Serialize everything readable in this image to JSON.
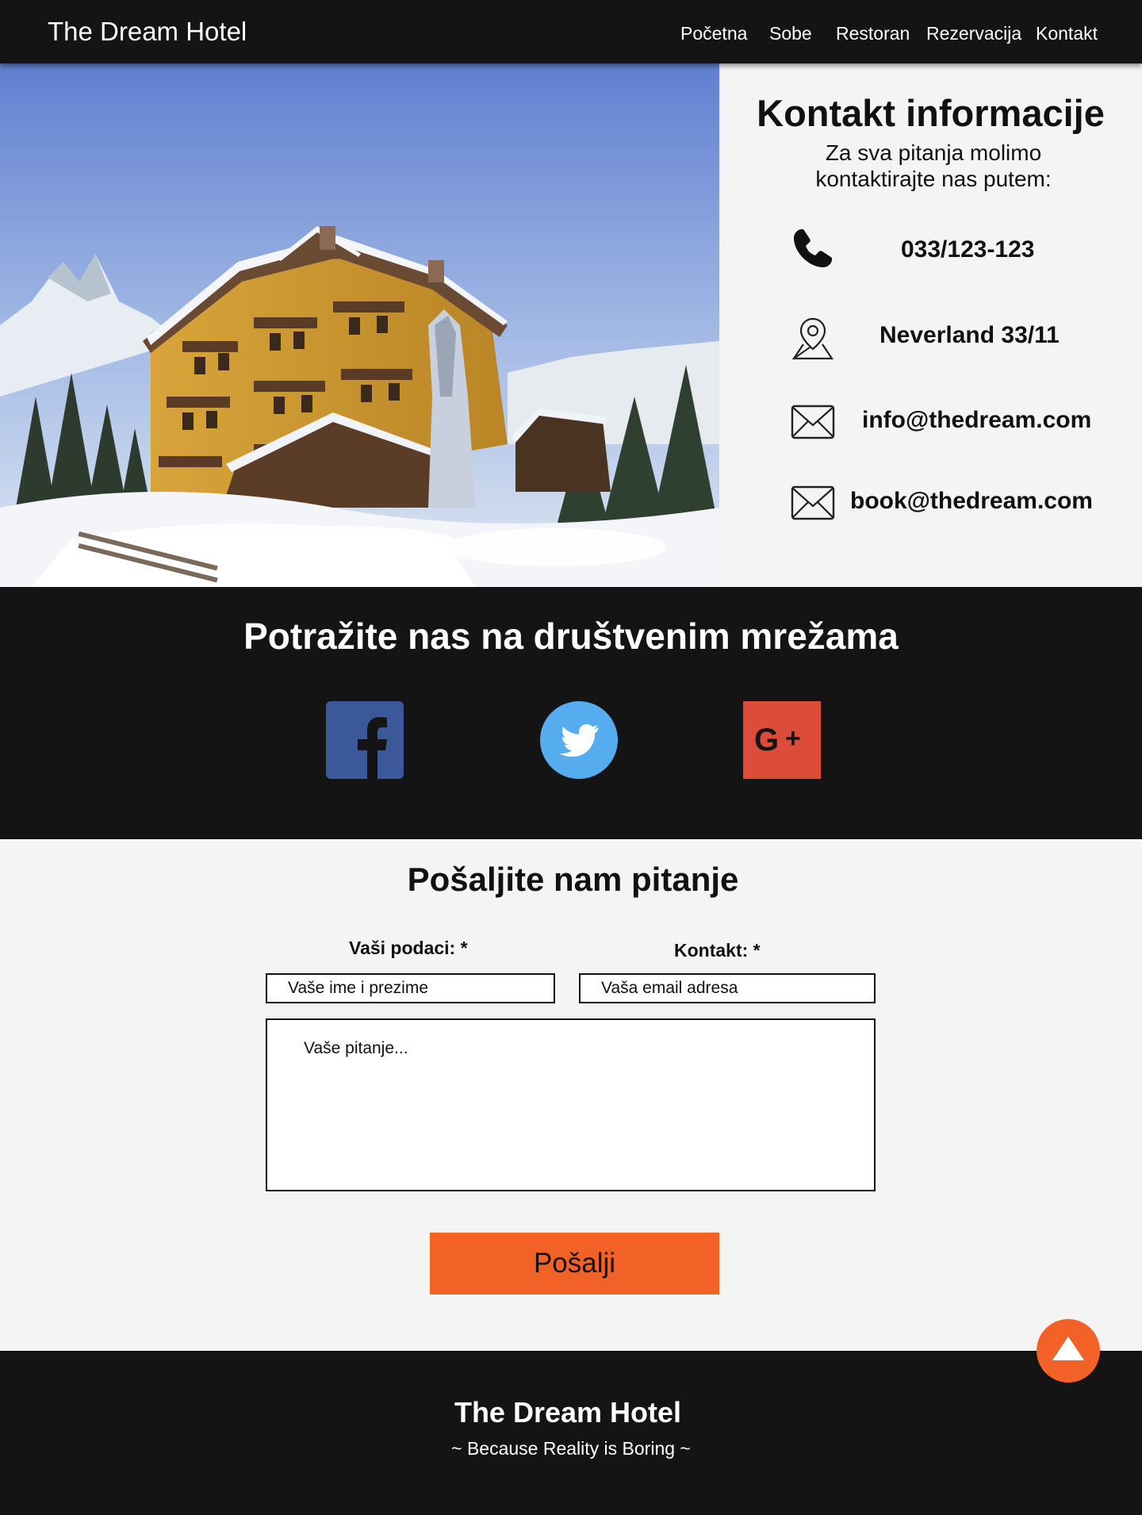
{
  "nav": {
    "brand": "The Dream Hotel",
    "items": [
      {
        "label": "Početna"
      },
      {
        "label": "Sobe"
      },
      {
        "label": "Restoran"
      },
      {
        "label": "Rezervacija"
      },
      {
        "label": "Kontakt"
      }
    ]
  },
  "hero": {
    "image_icon": "snowy-alpine-hotel-photo"
  },
  "contact": {
    "title": "Kontakt informacije",
    "subtitle": "Za sva pitanja molimo kontaktirajte nas putem:",
    "phone": "033/123-123",
    "address": "Neverland 33/11",
    "email_info": "info@thedream.com",
    "email_book": "book@thedream.com",
    "icons": [
      "phone-icon",
      "location-pin-icon",
      "envelope-icon",
      "envelope-icon"
    ]
  },
  "social": {
    "title": "Potražite nas na društvenim mrežama",
    "networks": [
      {
        "icon": "facebook-icon",
        "color": "#3b5998"
      },
      {
        "icon": "twitter-icon",
        "color": "#55acee"
      },
      {
        "icon": "google-plus-icon",
        "color": "#dd4b39"
      }
    ]
  },
  "form": {
    "title": "Pošaljite nam pitanje",
    "label_data": "Vaši podaci: *",
    "label_contact": "Kontakt: *",
    "name_placeholder": "Vaše ime i prezime",
    "email_placeholder": "Vaša email adresa",
    "question_placeholder": "Vaše pitanje...",
    "submit_label": "Pošalji",
    "accent": "#f26125"
  },
  "scroll_top": {
    "icon": "arrow-up-icon"
  },
  "footer": {
    "title": "The Dream Hotel",
    "tagline": "~ Because Reality is Boring ~"
  }
}
